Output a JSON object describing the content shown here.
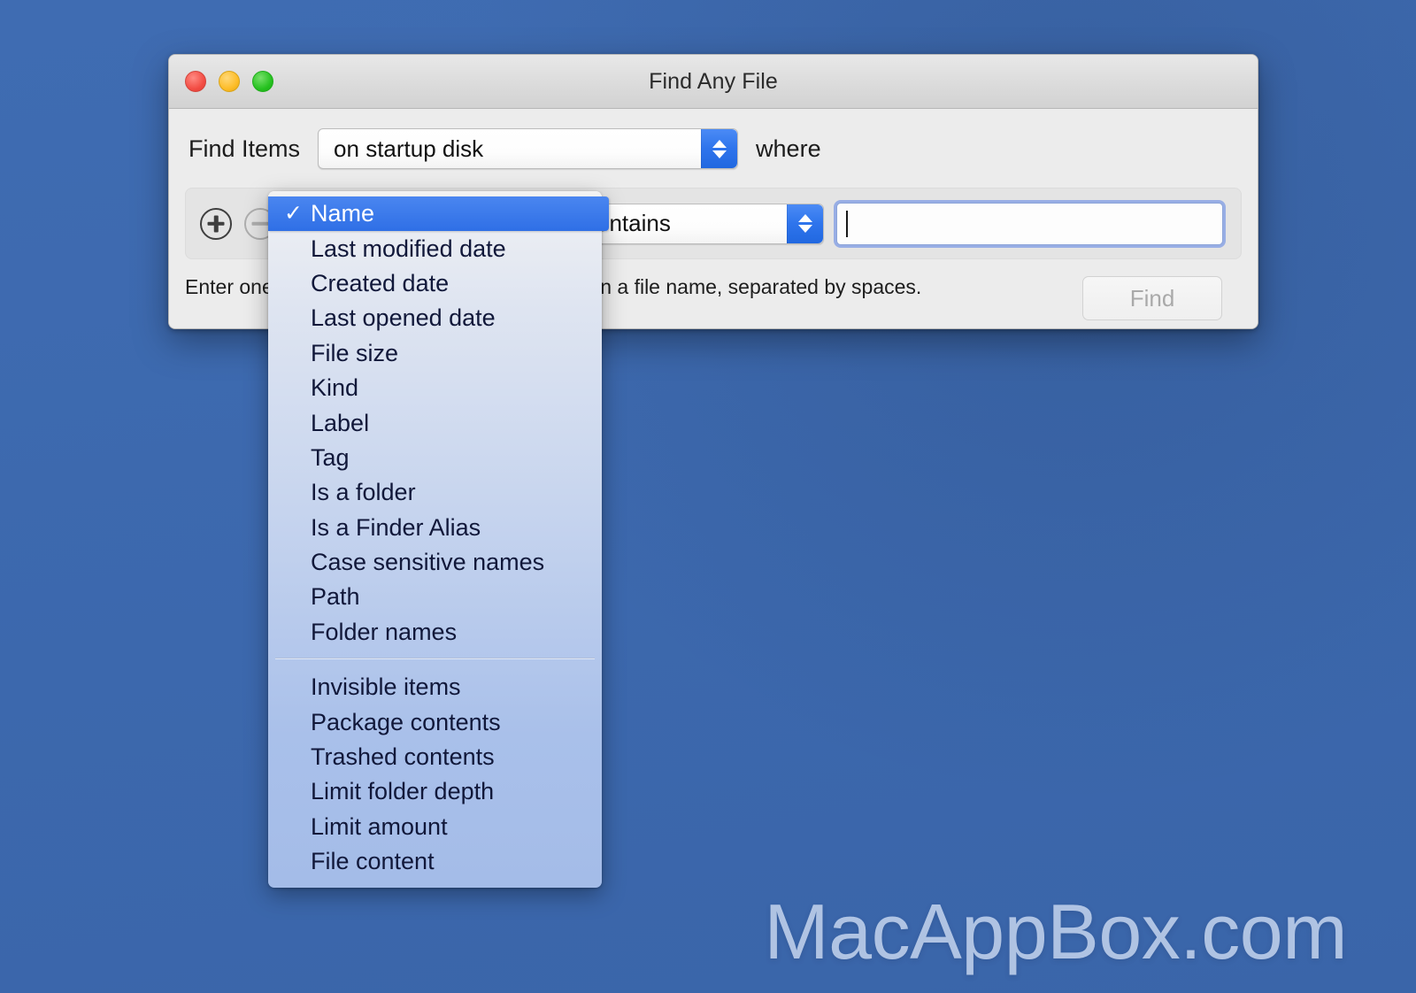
{
  "window": {
    "title": "Find Any File",
    "traffic_lights": [
      {
        "name": "close",
        "color": "#f24c43"
      },
      {
        "name": "minimize",
        "color": "#fdbc27"
      },
      {
        "name": "zoom",
        "color": "#25c11f"
      }
    ]
  },
  "scope_row": {
    "label": "Find Items",
    "popup_value": "on startup disk",
    "suffix_label": "where"
  },
  "criteria_row": {
    "add_button_label": "+",
    "remove_button_label": "−",
    "attribute_value": "Name",
    "operator_value": "contains",
    "value_field_text": "",
    "value_field_placeholder": ""
  },
  "hint": {
    "text": "Enter one or more words that have to appear in a file name, separated by spaces."
  },
  "find_button": {
    "label": "Find",
    "enabled": false
  },
  "menu": {
    "selected_item": "Name",
    "check_glyph": "✓",
    "groups": [
      {
        "items": [
          "Name",
          "Last modified date",
          "Created date",
          "Last opened date",
          "File size",
          "Kind",
          "Label",
          "Tag",
          "Is a folder",
          "Is a Finder Alias",
          "Case sensitive names",
          "Path",
          "Folder names"
        ]
      },
      {
        "items": [
          "Invisible items",
          "Package contents",
          "Trashed contents",
          "Limit folder depth",
          "Limit amount",
          "File content"
        ]
      }
    ]
  },
  "watermark": {
    "text": "MacAppBox.com"
  },
  "colors": {
    "desktop": "#3d6ab0",
    "accent_blue": "#2f6fe6",
    "menu_text": "#11183a",
    "window_chrome": "#ececec"
  }
}
